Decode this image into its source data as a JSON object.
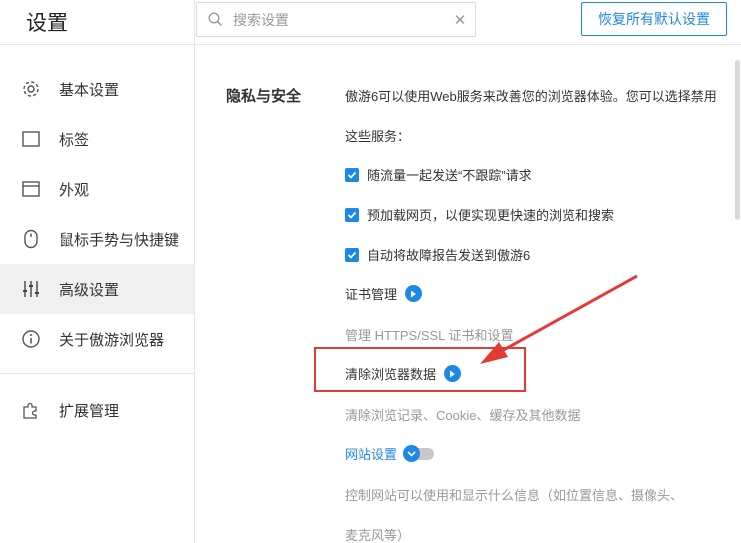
{
  "header": {
    "title": "设置",
    "search_placeholder": "搜索设置",
    "clear_icon": "close-icon",
    "restore_label": "恢复所有默认设置"
  },
  "sidebar": {
    "items": [
      {
        "label": "基本设置",
        "icon": "gear-icon"
      },
      {
        "label": "标签",
        "icon": "tab-icon"
      },
      {
        "label": "外观",
        "icon": "window-icon"
      },
      {
        "label": "鼠标手势与快捷键",
        "icon": "mouse-icon"
      },
      {
        "label": "高级设置",
        "icon": "sliders-icon",
        "active": true
      },
      {
        "label": "关于傲游浏览器",
        "icon": "info-icon"
      }
    ],
    "extension": {
      "label": "扩展管理",
      "icon": "puzzle-icon"
    }
  },
  "privacy": {
    "title": "隐私与安全",
    "intro_line1": "傲游6可以使用Web服务来改善您的浏览器体验。您可以选择禁用",
    "intro_line2": "这些服务：",
    "options": [
      {
        "label": "随流量一起发送“不跟踪”请求",
        "checked": true
      },
      {
        "label": "预加载网页，以便实现更快速的浏览和搜索",
        "checked": true
      },
      {
        "label": "自动将故障报告发送到傲游6",
        "checked": true
      }
    ],
    "cert": {
      "label": "证书管理",
      "desc": "管理 HTTPS/SSL 证书和设置"
    },
    "clear_data": {
      "label": "清除浏览器数据",
      "desc": "清除浏览记录、Cookie、缓存及其他数据"
    },
    "site_settings": {
      "label": "网站设置",
      "desc_line1": "控制网站可以使用和显示什么信息（如位置信息、摄像头、",
      "desc_line2": "麦克风等）"
    }
  },
  "colors": {
    "accent": "#1e88e5",
    "annotation": "#e53935"
  }
}
